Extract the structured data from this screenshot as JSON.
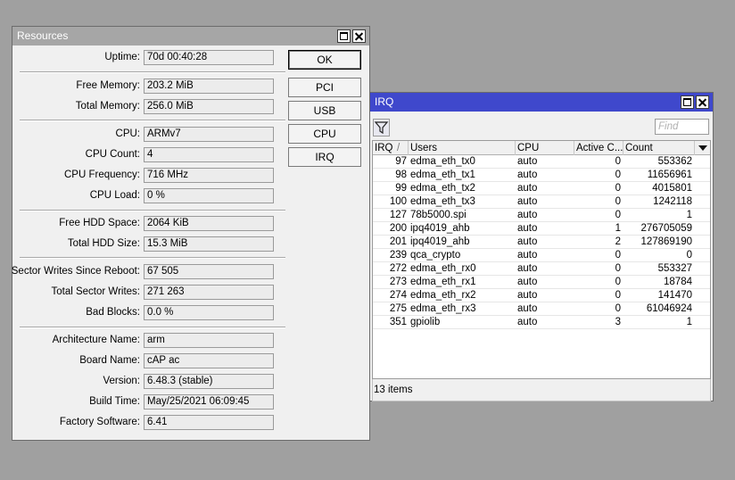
{
  "resources": {
    "title": "Resources",
    "fields": {
      "uptime": {
        "label": "Uptime:",
        "value": "70d 00:40:28"
      },
      "free_memory": {
        "label": "Free Memory:",
        "value": "203.2 MiB"
      },
      "total_memory": {
        "label": "Total Memory:",
        "value": "256.0 MiB"
      },
      "cpu": {
        "label": "CPU:",
        "value": "ARMv7"
      },
      "cpu_count": {
        "label": "CPU Count:",
        "value": "4"
      },
      "cpu_frequency": {
        "label": "CPU Frequency:",
        "value": "716 MHz"
      },
      "cpu_load": {
        "label": "CPU Load:",
        "value": "0 %"
      },
      "free_hdd": {
        "label": "Free HDD Space:",
        "value": "2064 KiB"
      },
      "total_hdd": {
        "label": "Total HDD Size:",
        "value": "15.3 MiB"
      },
      "sector_writes_reboot": {
        "label": "Sector Writes Since Reboot:",
        "value": "67 505"
      },
      "total_sector_writes": {
        "label": "Total Sector Writes:",
        "value": "271 263"
      },
      "bad_blocks": {
        "label": "Bad Blocks:",
        "value": "0.0 %"
      },
      "architecture": {
        "label": "Architecture Name:",
        "value": "arm"
      },
      "board_name": {
        "label": "Board Name:",
        "value": "cAP ac"
      },
      "version": {
        "label": "Version:",
        "value": "6.48.3 (stable)"
      },
      "build_time": {
        "label": "Build Time:",
        "value": "May/25/2021 06:09:45"
      },
      "factory_software": {
        "label": "Factory Software:",
        "value": "6.41"
      }
    },
    "buttons": {
      "ok": "OK",
      "pci": "PCI",
      "usb": "USB",
      "cpu": "CPU",
      "irq": "IRQ"
    }
  },
  "irq": {
    "title": "IRQ",
    "find_placeholder": "Find",
    "columns": {
      "irq": "IRQ",
      "users": "Users",
      "cpu": "CPU",
      "active_cpu": "Active C...",
      "count": "Count"
    },
    "rows": [
      {
        "irq": "97",
        "users": "edma_eth_tx0",
        "cpu": "auto",
        "active": "0",
        "count": "553362"
      },
      {
        "irq": "98",
        "users": "edma_eth_tx1",
        "cpu": "auto",
        "active": "0",
        "count": "11656961"
      },
      {
        "irq": "99",
        "users": "edma_eth_tx2",
        "cpu": "auto",
        "active": "0",
        "count": "4015801"
      },
      {
        "irq": "100",
        "users": "edma_eth_tx3",
        "cpu": "auto",
        "active": "0",
        "count": "1242118"
      },
      {
        "irq": "127",
        "users": "78b5000.spi",
        "cpu": "auto",
        "active": "0",
        "count": "1"
      },
      {
        "irq": "200",
        "users": "ipq4019_ahb",
        "cpu": "auto",
        "active": "1",
        "count": "276705059"
      },
      {
        "irq": "201",
        "users": "ipq4019_ahb",
        "cpu": "auto",
        "active": "2",
        "count": "127869190"
      },
      {
        "irq": "239",
        "users": "qca_crypto",
        "cpu": "auto",
        "active": "0",
        "count": "0"
      },
      {
        "irq": "272",
        "users": "edma_eth_rx0",
        "cpu": "auto",
        "active": "0",
        "count": "553327"
      },
      {
        "irq": "273",
        "users": "edma_eth_rx1",
        "cpu": "auto",
        "active": "0",
        "count": "18784"
      },
      {
        "irq": "274",
        "users": "edma_eth_rx2",
        "cpu": "auto",
        "active": "0",
        "count": "141470"
      },
      {
        "irq": "275",
        "users": "edma_eth_rx3",
        "cpu": "auto",
        "active": "0",
        "count": "61046924"
      },
      {
        "irq": "351",
        "users": "gpiolib",
        "cpu": "auto",
        "active": "3",
        "count": "1"
      }
    ],
    "status": "13 items"
  }
}
